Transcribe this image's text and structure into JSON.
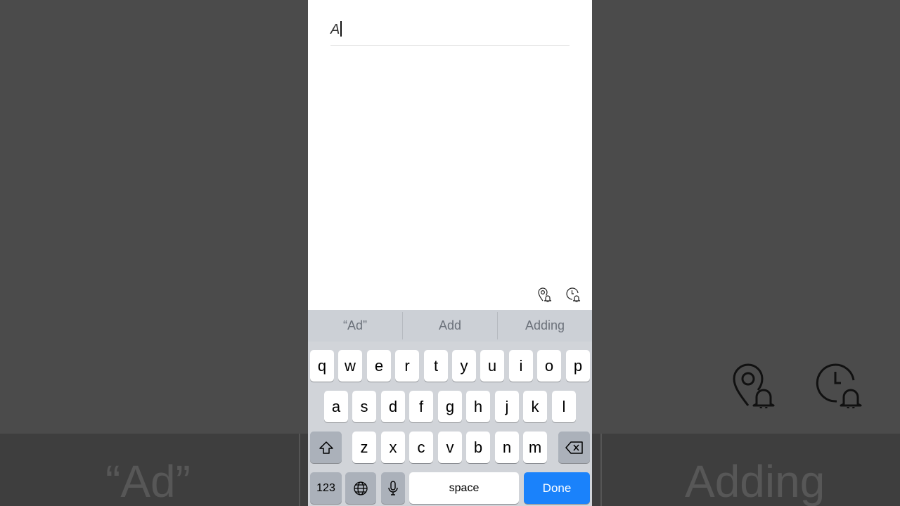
{
  "note": {
    "title_value": "A"
  },
  "reminder_icons": [
    "location-reminder-icon",
    "time-reminder-icon"
  ],
  "predictions": [
    "“Ad”",
    "Add",
    "Adding"
  ],
  "keyboard": {
    "row1": [
      "q",
      "w",
      "e",
      "r",
      "t",
      "y",
      "u",
      "i",
      "o",
      "p"
    ],
    "row2": [
      "a",
      "s",
      "d",
      "f",
      "g",
      "h",
      "j",
      "k",
      "l"
    ],
    "row3": [
      "z",
      "x",
      "c",
      "v",
      "b",
      "n",
      "m"
    ],
    "numbers_label": "123",
    "space_label": "space",
    "done_label": "Done"
  },
  "colors": {
    "done_key": "#1a82fb",
    "keyboard_bg": "#d1d4d9",
    "background": "#4a4a4a"
  }
}
